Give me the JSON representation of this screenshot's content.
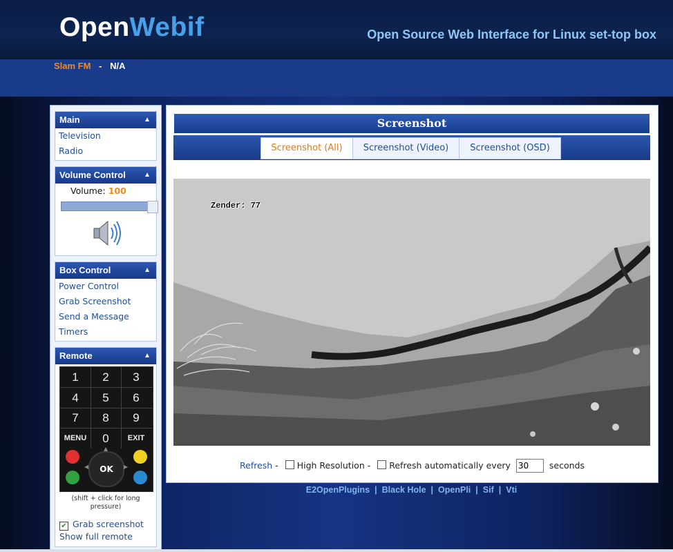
{
  "header": {
    "logo_part1": "Open",
    "logo_part2": "Webif",
    "tagline": "Open Source Web Interface for Linux set-top box",
    "channel": "Slam FM",
    "separator": "-",
    "event": "N/A"
  },
  "sidebar": {
    "main": {
      "title": "Main",
      "items": [
        {
          "label": "Television"
        },
        {
          "label": "Radio"
        }
      ]
    },
    "volume": {
      "title": "Volume Control",
      "label": "Volume:",
      "value": "100",
      "level": 1.0
    },
    "box_control": {
      "title": "Box Control",
      "items": [
        {
          "label": "Power Control"
        },
        {
          "label": "Grab Screenshot"
        },
        {
          "label": "Send a Message"
        },
        {
          "label": "Timers"
        }
      ]
    },
    "remote": {
      "title": "Remote",
      "keys": [
        "1",
        "2",
        "3",
        "4",
        "5",
        "6",
        "7",
        "8",
        "9",
        "MENU",
        "0",
        "EXIT"
      ],
      "ok": "OK",
      "hint": "(shift + click for long pressure)",
      "grab_label": "Grab screenshot",
      "grab_checked": true,
      "show_full": "Show full remote"
    }
  },
  "main": {
    "title": "Screenshot",
    "tabs": [
      {
        "label": "Screenshot (All)",
        "active": true
      },
      {
        "label": "Screenshot (Video)",
        "active": false
      },
      {
        "label": "Screenshot (OSD)",
        "active": false
      }
    ],
    "osd_text": "Zender:  77",
    "refresh": {
      "refresh_link": "Refresh",
      "dash1": "-",
      "high_res": "High Resolution",
      "dash2": "-",
      "auto_label": "Refresh automatically every",
      "interval": "30",
      "seconds": "seconds"
    }
  },
  "footer": {
    "links": [
      "E2OpenPlugins",
      "Black Hole",
      "OpenPli",
      "Sif",
      "Vti"
    ]
  },
  "colors": {
    "accent_orange": "#f08a1a",
    "header_blue": "#1a3a8a",
    "link_blue": "#1d4f9c",
    "logo_blue": "#4aa0e8"
  }
}
